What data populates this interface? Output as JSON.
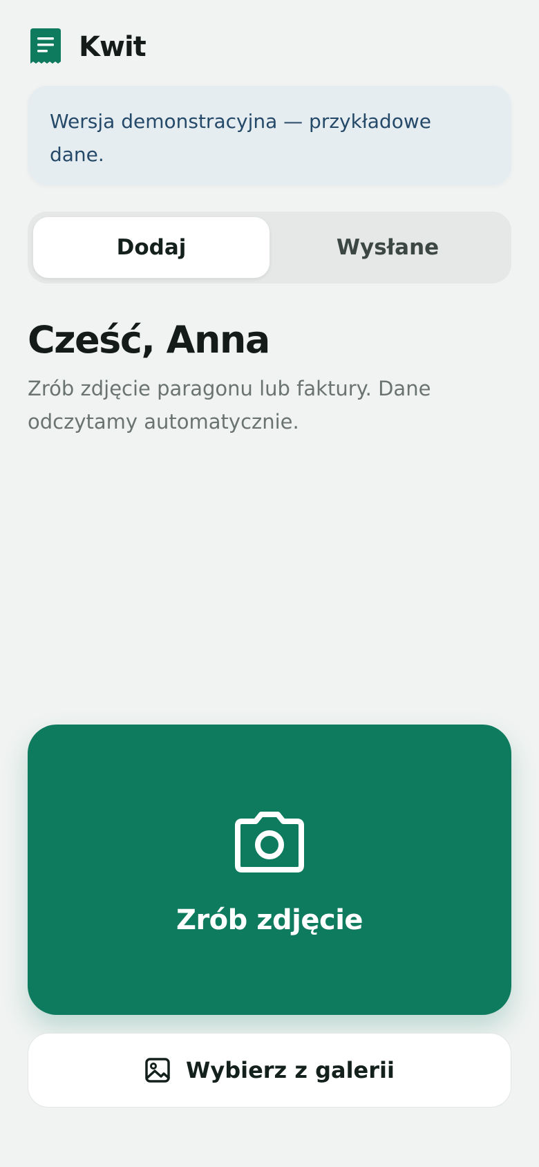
{
  "app": {
    "title": "Kwit",
    "logo_icon": "receipt-icon",
    "brand_color": "#0e7b5e"
  },
  "banner": {
    "text": "Wersja demonstracyjna — przykładowe dane."
  },
  "tabs": [
    {
      "label": "Dodaj",
      "active": true
    },
    {
      "label": "Wysłane",
      "active": false
    }
  ],
  "greeting": {
    "title": "Cześć, Anna",
    "subtitle": "Zrób zdjęcie paragonu lub faktury. Dane odczytamy automatycznie."
  },
  "actions": {
    "camera_label": "Zrób zdjęcie",
    "camera_icon": "camera-icon",
    "gallery_label": "Wybierz z galerii",
    "gallery_icon": "image-icon"
  }
}
